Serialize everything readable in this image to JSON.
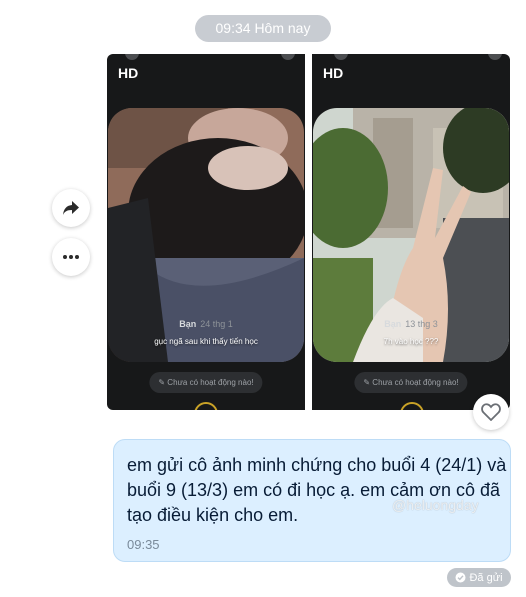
{
  "header": {
    "time_label": "09:34 Hôm nay"
  },
  "actions": {
    "share_icon": "share-forward-icon",
    "more_icon": "more-dots-icon"
  },
  "photos": [
    {
      "quality": "HD",
      "caption": "gục ngã sau khi thấy tiến học",
      "sender": "Bạn",
      "date": "24 thg 1",
      "activity": "✎ Chưa có hoạt động nào!"
    },
    {
      "quality": "HD",
      "caption": "7h vào học ???",
      "sender": "Bạn",
      "date": "13 thg 3",
      "activity": "✎ Chưa có hoạt động nào!"
    }
  ],
  "message": {
    "text": "em gửi cô ảnh minh chứng cho buổi 4 (24/1) và buổi 9 (13/3) em có đi học ạ. em cảm ơn cô đã tạo điều kiện cho em.",
    "time": "09:35",
    "watermark": "@heluongday"
  },
  "status": {
    "label": "Đã gửi",
    "icon": "check-icon"
  },
  "colors": {
    "bubble": "#dcefff",
    "card_bg": "#171819",
    "time_pill": "#c8ccd2",
    "status_pill": "#bfc4ca"
  }
}
